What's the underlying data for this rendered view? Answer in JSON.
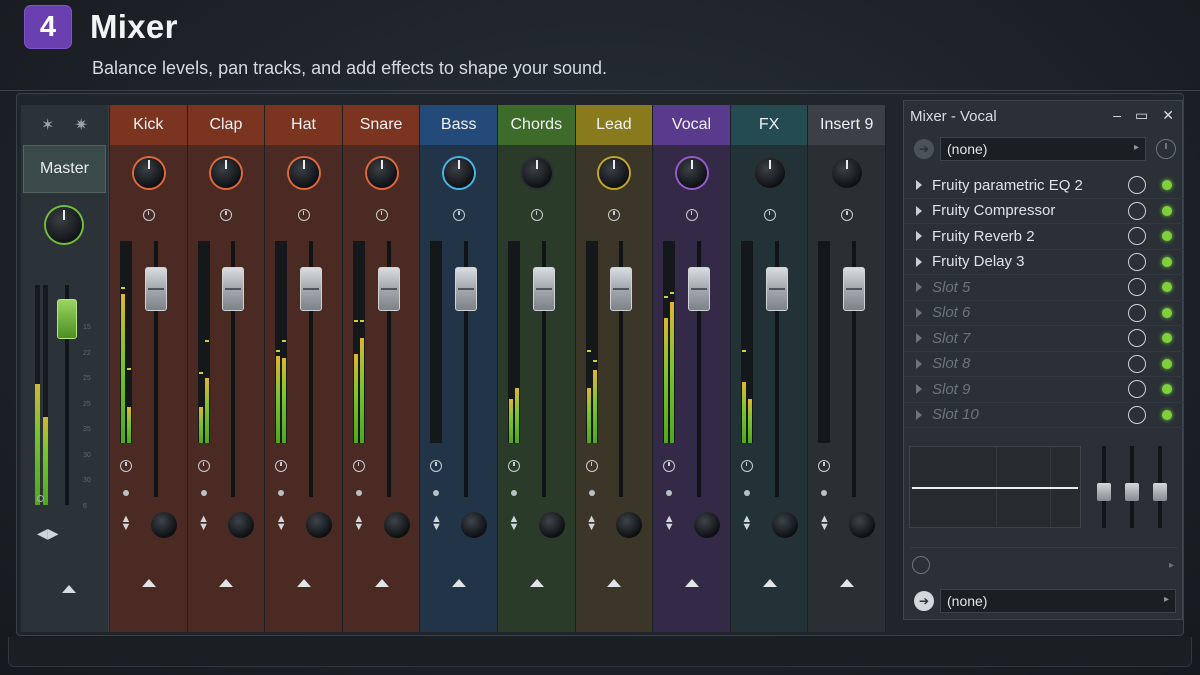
{
  "header": {
    "step_number": "4",
    "title": "Mixer",
    "subtitle": "Balance levels, pan tracks, and add effects to shape your sound."
  },
  "master": {
    "label": "Master",
    "meters": [
      0.55,
      0.4
    ],
    "fader_level": 0.92,
    "scale": [
      "15",
      "",
      "22",
      "25",
      "25",
      "35",
      "30",
      "30",
      "6"
    ]
  },
  "channels": [
    {
      "name": "Kick",
      "color": "#7a3420",
      "body": "#4a2a22",
      "knob_ring": "#e0683a",
      "meters": [
        0.74,
        0.18
      ],
      "peaks": [
        0.76,
        0.36
      ],
      "fader_level": 0.89
    },
    {
      "name": "Clap",
      "color": "#7a3420",
      "body": "#4a2a22",
      "knob_ring": "#e0683a",
      "meters": [
        0.18,
        0.32
      ],
      "peaks": [
        0.34,
        0.5
      ],
      "fader_level": 0.89
    },
    {
      "name": "Hat",
      "color": "#7a3420",
      "body": "#4a2a22",
      "knob_ring": "#e0683a",
      "meters": [
        0.43,
        0.42
      ],
      "peaks": [
        0.45,
        0.5
      ],
      "fader_level": 0.89
    },
    {
      "name": "Snare",
      "color": "#7a3420",
      "body": "#4a2a22",
      "knob_ring": "#e0683a",
      "meters": [
        0.44,
        0.52
      ],
      "peaks": [
        0.6,
        0.6
      ],
      "fader_level": 0.89
    },
    {
      "name": "Bass",
      "color": "#244a7a",
      "body": "#223448",
      "knob_ring": "#4bb6e6",
      "meters": [
        0,
        0
      ],
      "peaks": [
        0,
        0
      ],
      "fader_level": 0.89
    },
    {
      "name": "Chords",
      "color": "#3e6a2a",
      "body": "#2b3b2a",
      "knob_ring": "#2a3030",
      "meters": [
        0.22,
        0.27
      ],
      "peaks": [
        0,
        0
      ],
      "fader_level": 0.89
    },
    {
      "name": "Lead",
      "color": "#8a7a1e",
      "body": "#3b3628",
      "knob_ring": "#c7a42a",
      "meters": [
        0.27,
        0.36
      ],
      "peaks": [
        0.45,
        0.4
      ],
      "fader_level": 0.89
    },
    {
      "name": "Vocal",
      "color": "#5a3a8c",
      "body": "#342a48",
      "knob_ring": "#9a5ad0",
      "meters": [
        0.62,
        0.7
      ],
      "peaks": [
        0.72,
        0.74
      ],
      "fader_level": 0.89
    },
    {
      "name": "FX",
      "color": "#244a52",
      "body": "#233236",
      "knob_ring": "#2a3030",
      "meters": [
        0.3,
        0.22
      ],
      "peaks": [
        0.45,
        0
      ],
      "fader_level": 0.89
    },
    {
      "name": "Insert 9",
      "color": "#3a4046",
      "body": "#2a2f34",
      "knob_ring": "#2a3030",
      "meters": [
        0,
        0
      ],
      "peaks": [
        0,
        0
      ],
      "fader_level": 0.89
    }
  ],
  "panel": {
    "title": "Mixer - Vocal",
    "minimize": "–",
    "maximize": "▭",
    "close": "✕",
    "input_value": "(none)",
    "output_value": "(none)",
    "slots": [
      {
        "label": "Fruity parametric EQ 2",
        "empty": false
      },
      {
        "label": "Fruity Compressor",
        "empty": false
      },
      {
        "label": "Fruity Reverb 2",
        "empty": false
      },
      {
        "label": "Fruity Delay 3",
        "empty": false
      },
      {
        "label": "Slot 5",
        "empty": true
      },
      {
        "label": "Slot 6",
        "empty": true
      },
      {
        "label": "Slot 7",
        "empty": true
      },
      {
        "label": "Slot 8",
        "empty": true
      },
      {
        "label": "Slot 9",
        "empty": true
      },
      {
        "label": "Slot 10",
        "empty": true
      }
    ]
  },
  "icons": {
    "pin": "pin-icon",
    "star": "star-icon",
    "pan": "pan-icon",
    "route": "route-up-icon"
  }
}
